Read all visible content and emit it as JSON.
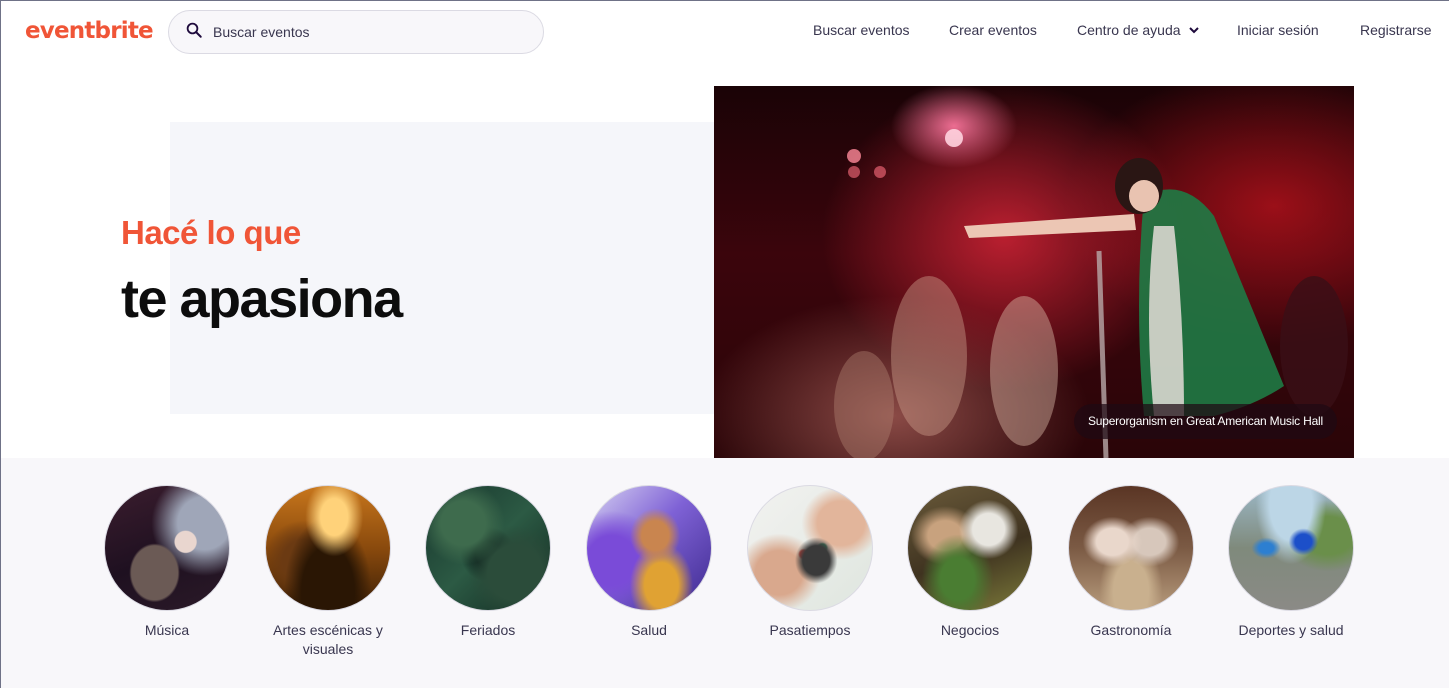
{
  "header": {
    "logo": "eventbrite",
    "search": {
      "placeholder": "Buscar eventos",
      "value": ""
    },
    "nav": [
      {
        "label": "Buscar eventos"
      },
      {
        "label": "Crear eventos"
      },
      {
        "label": "Centro de ayuda",
        "has_dropdown": true
      },
      {
        "label": "Iniciar sesión"
      },
      {
        "label": "Registrarse"
      }
    ]
  },
  "hero": {
    "line1": "Hacé lo que",
    "line2": "te apasiona",
    "image_caption": "Superorganism en Great American Music Hall"
  },
  "categories": [
    {
      "label": "Música"
    },
    {
      "label": "Artes escénicas y visuales"
    },
    {
      "label": "Feriados"
    },
    {
      "label": "Salud"
    },
    {
      "label": "Pasatiempos"
    },
    {
      "label": "Negocios"
    },
    {
      "label": "Gastronomía"
    },
    {
      "label": "Deportes y salud"
    }
  ],
  "colors": {
    "brand": "#f05537",
    "text": "#39364f",
    "hero_panel": "#f5f6fa",
    "category_band": "#f8f7fa"
  }
}
